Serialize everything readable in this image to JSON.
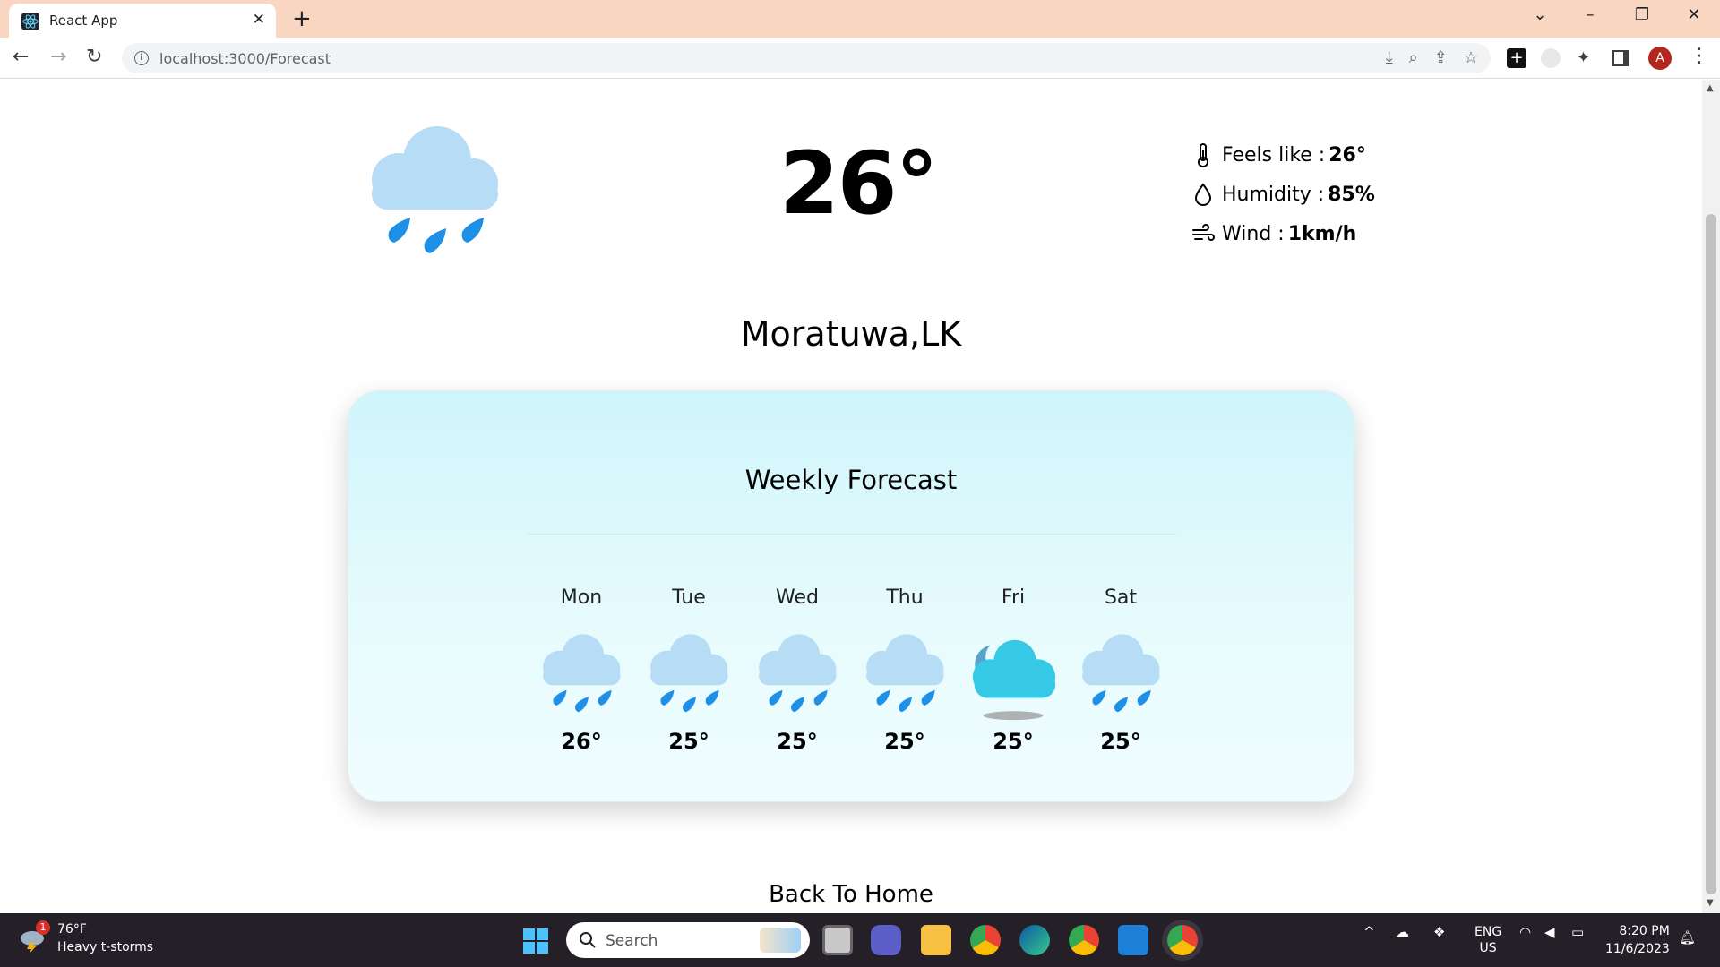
{
  "browser": {
    "tab_title": "React App",
    "url": "localhost:3000/Forecast",
    "profile_initial": "A"
  },
  "current": {
    "temperature": "26°",
    "icon": "rain-cloud-icon",
    "feels_like_label": "Feels like :",
    "feels_like_value": "26°",
    "humidity_label": "Humidity :",
    "humidity_value": "85%",
    "wind_label": "Wind :",
    "wind_value": "1km/h"
  },
  "location": "Moratuwa,LK",
  "weekly": {
    "title": "Weekly Forecast",
    "days": [
      {
        "name": "Mon",
        "temp": "26°",
        "icon": "rain-cloud-icon"
      },
      {
        "name": "Tue",
        "temp": "25°",
        "icon": "rain-cloud-icon"
      },
      {
        "name": "Wed",
        "temp": "25°",
        "icon": "rain-cloud-icon"
      },
      {
        "name": "Thu",
        "temp": "25°",
        "icon": "rain-cloud-icon"
      },
      {
        "name": "Fri",
        "temp": "25°",
        "icon": "cloudy-night-icon"
      },
      {
        "name": "Sat",
        "temp": "25°",
        "icon": "rain-cloud-icon"
      }
    ]
  },
  "back_link": "Back To Home",
  "taskbar": {
    "weather_temp": "76°F",
    "weather_desc": "Heavy t-storms",
    "weather_badge": "1",
    "search_placeholder": "Search",
    "lang_line1": "ENG",
    "lang_line2": "US",
    "time": "8:20 PM",
    "date": "11/6/2023"
  },
  "colors": {
    "card_top": "#cff5fb",
    "cloud_light": "#b7dcf5",
    "raindrop": "#1e90e8",
    "cloud_cyan": "#35c9e6",
    "tabstrip": "#f8d6c2"
  }
}
